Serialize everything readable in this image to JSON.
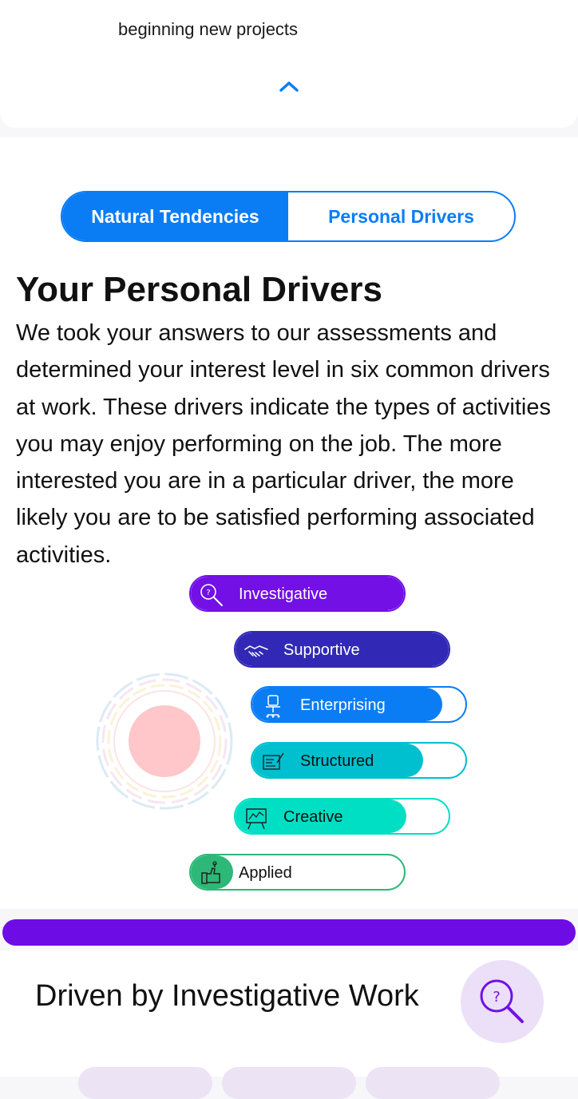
{
  "top_card": {
    "text": "beginning new projects",
    "collapse_icon": "chevron-up-icon"
  },
  "tabs": [
    {
      "label": "Natural Tendencies",
      "active": true
    },
    {
      "label": "Personal Drivers",
      "active": false
    }
  ],
  "section": {
    "title": "Your Personal Drivers",
    "description": "We took your answers to our assessments and determined your interest level in six common drivers at work. These drivers indicate the types of activities you may enjoy performing on the job. The more interested you are in a particular driver, the more likely you are to be satisfied performing associated activities."
  },
  "drivers": [
    {
      "label": "Investigative",
      "level": 1.0,
      "color": "#7210e6",
      "icon": "magnifier-question-icon"
    },
    {
      "label": "Supportive",
      "level": 1.0,
      "color": "#3129b5",
      "icon": "handshake-icon"
    },
    {
      "label": "Enterprising",
      "level": 0.89,
      "color": "#0a7df5",
      "icon": "office-chair-icon"
    },
    {
      "label": "Structured",
      "level": 0.8,
      "color": "#00bfcf",
      "icon": "chart-board-icon"
    },
    {
      "label": "Creative",
      "level": 0.8,
      "color": "#00dfc4",
      "icon": "easel-icon"
    },
    {
      "label": "Applied",
      "level": 0.2,
      "color": "#2db877",
      "icon": "thumbs-up-tool-icon"
    }
  ],
  "colors": {
    "accent": "#0a7df5",
    "investigative": "#6e0ce6",
    "deco_circle": "#ffc7c9"
  },
  "bottom": {
    "title": "Driven by Investigative Work",
    "icon": "magnifier-question-icon"
  }
}
